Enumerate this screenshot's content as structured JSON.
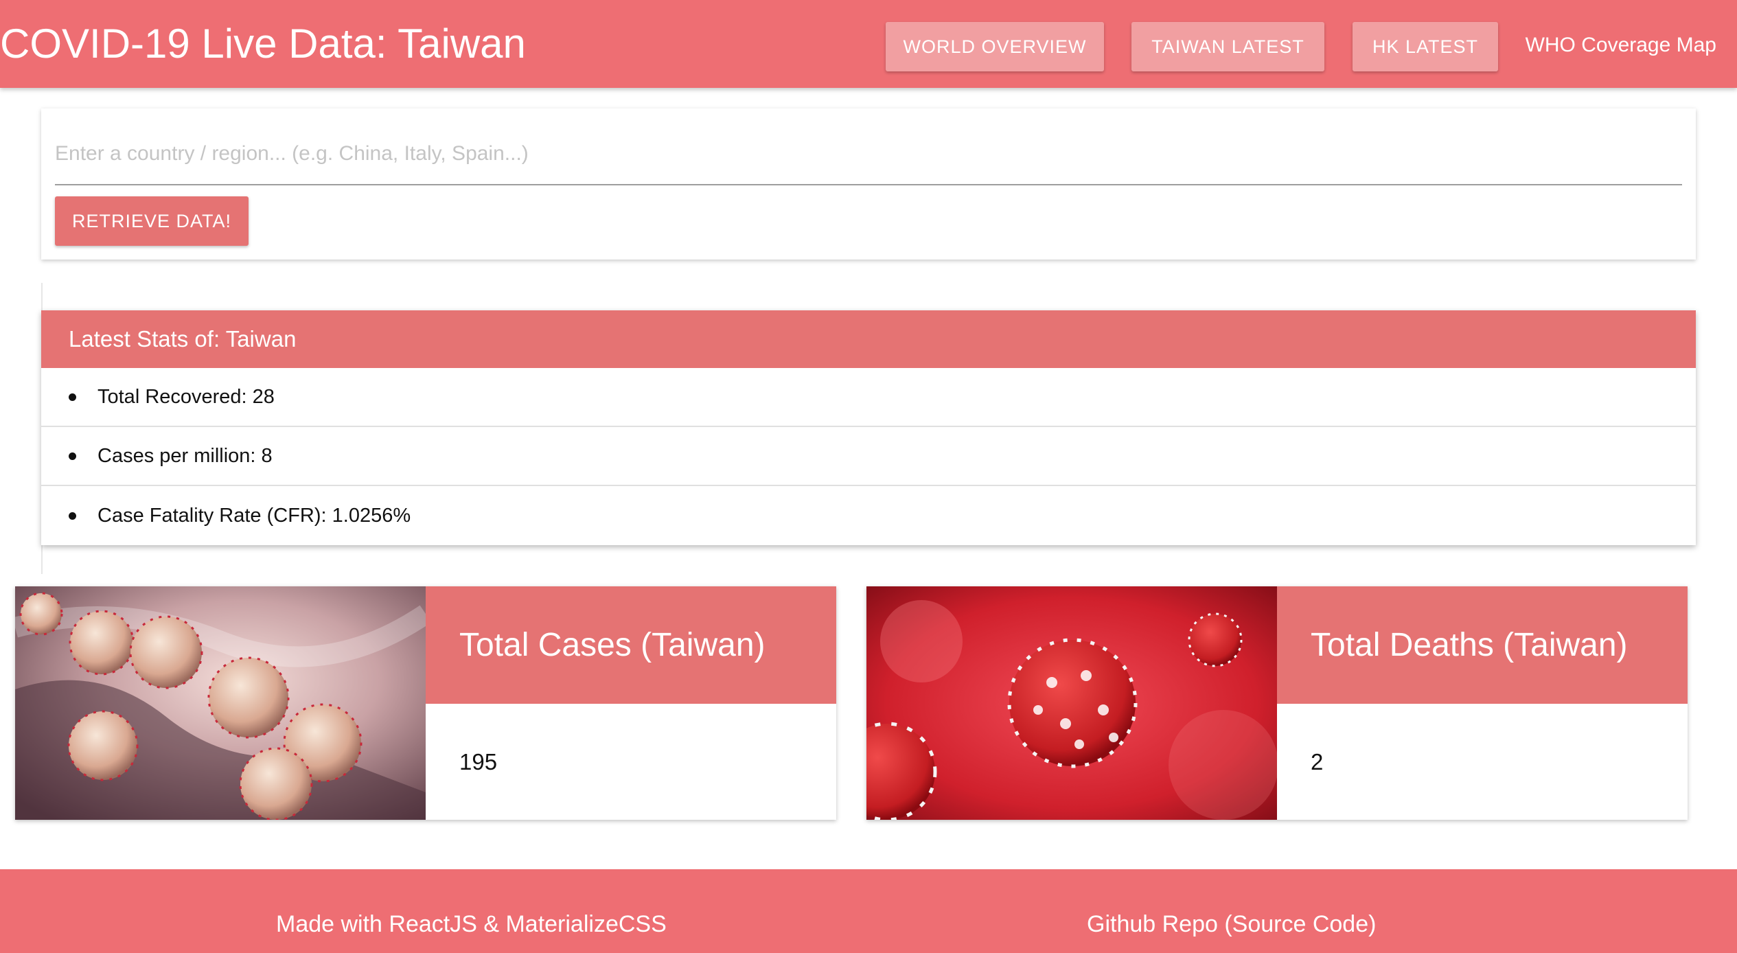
{
  "navbar": {
    "brand": "COVID-19 Live Data: Taiwan",
    "buttons": [
      "WORLD OVERVIEW",
      "TAIWAN LATEST",
      "HK LATEST"
    ],
    "link": "WHO Coverage Map"
  },
  "search": {
    "placeholder": "Enter a country / region... (e.g. China, Italy, Spain...)",
    "value": "",
    "button_label": "RETRIEVE DATA!"
  },
  "stats": {
    "header": "Latest Stats of: Taiwan",
    "items": [
      "Total Recovered: 28",
      "Cases per million: 8",
      "Case Fatality Rate (CFR): 1.0256%"
    ]
  },
  "cards": [
    {
      "title": "Total Cases (Taiwan)",
      "value": "195",
      "image_icon": "coronavirus-illustration"
    },
    {
      "title": "Total Deaths (Taiwan)",
      "value": "2",
      "image_icon": "coronavirus-red-illustration"
    }
  ],
  "footer": {
    "credit": "Made with ReactJS & MaterializeCSS",
    "repo_link": "Github Repo (Source Code)"
  },
  "colors": {
    "accent": "#ee6e73",
    "card_header": "#e57373"
  }
}
